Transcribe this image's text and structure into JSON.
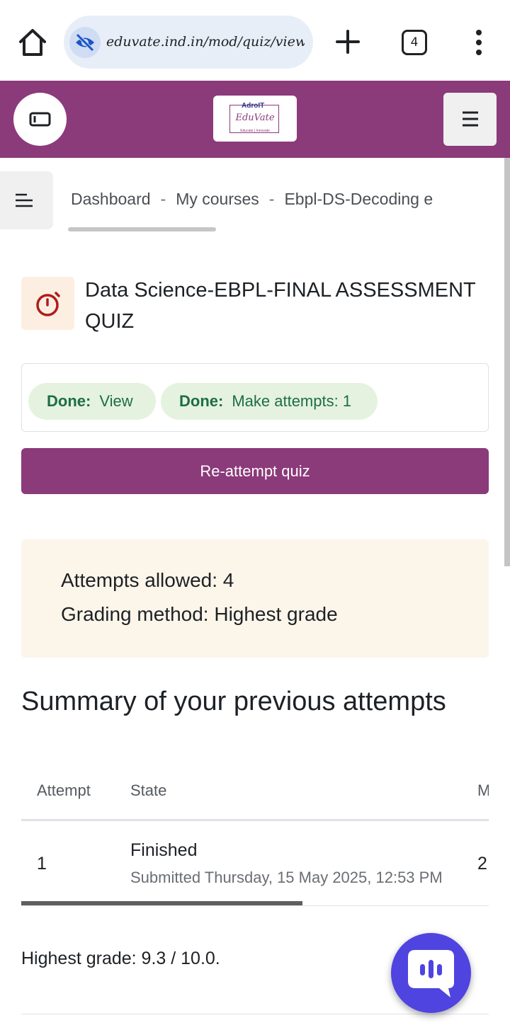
{
  "browser": {
    "url": "eduvate.ind.in/mod/quiz/view.p",
    "tab_count": "4"
  },
  "header": {
    "logo_brand": "AdroIT",
    "logo_name": "EduVate",
    "logo_tagline": "Educate | Innovate"
  },
  "breadcrumb": {
    "items": [
      "Dashboard",
      "My courses",
      "Ebpl-DS-Decoding e"
    ],
    "separator": "-"
  },
  "page": {
    "title": "Data Science-EBPL-FINAL ASSESSMENT QUIZ"
  },
  "completion": {
    "view_label": "Done:",
    "view_value": "View",
    "attempts_label": "Done:",
    "attempts_value": "Make attempts: 1"
  },
  "actions": {
    "reattempt_label": "Re-attempt quiz"
  },
  "quiz_info": {
    "attempts_allowed": "Attempts allowed: 4",
    "grading_method": "Grading method: Highest grade"
  },
  "summary": {
    "title": "Summary of your previous attempts",
    "columns": [
      "Attempt",
      "State",
      "M"
    ],
    "rows": [
      {
        "attempt": "1",
        "state": "Finished",
        "submitted": "Submitted Thursday, 15 May 2025, 12:53 PM",
        "marks": "2"
      }
    ]
  },
  "feedback": {
    "highest_grade": "Highest grade: 9.3 / 10.0."
  },
  "colors": {
    "brand": "#8b3a7a",
    "badge_bg": "#e5f2df",
    "badge_text": "#1d6e45",
    "info_bg": "#fcf5ea",
    "chat_fab": "#4f44e0"
  }
}
